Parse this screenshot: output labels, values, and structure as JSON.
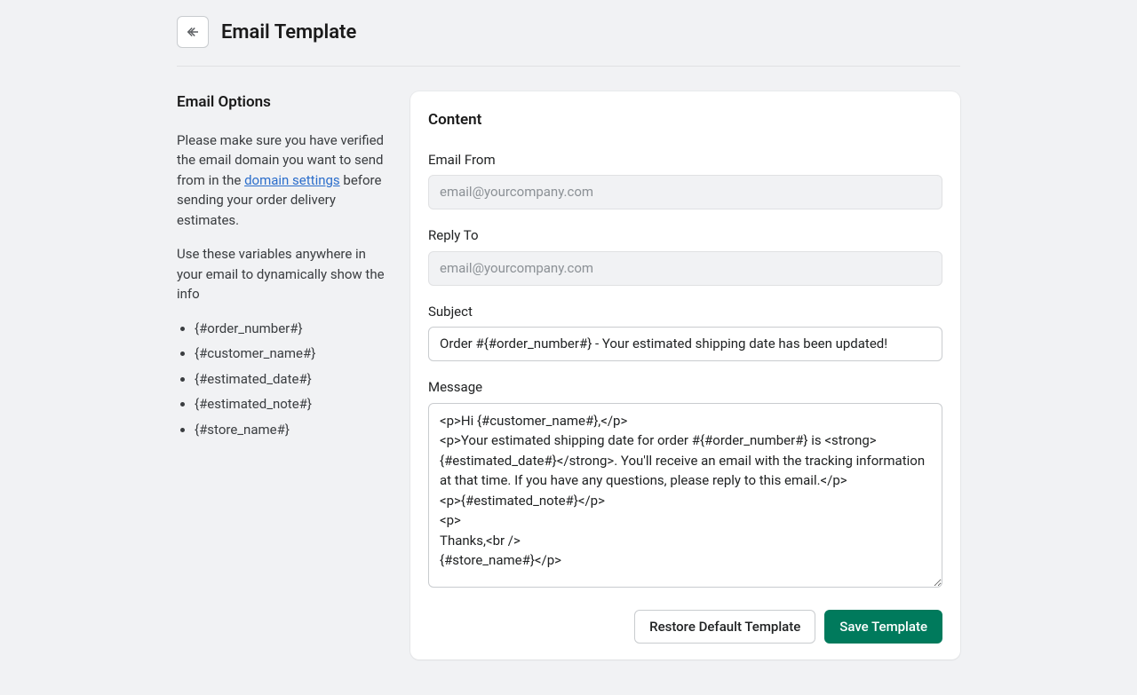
{
  "header": {
    "title": "Email Template"
  },
  "sidebar": {
    "title": "Email Options",
    "intro_part1": "Please make sure you have verified the email domain you want to send from in the ",
    "intro_link": "domain settings",
    "intro_part2": " before sending your order delivery estimates.",
    "variables_intro": "Use these variables anywhere in your email to dynamically show the info",
    "variables": [
      "{#order_number#}",
      "{#customer_name#}",
      "{#estimated_date#}",
      "{#estimated_note#}",
      "{#store_name#}"
    ]
  },
  "content": {
    "title": "Content",
    "email_from": {
      "label": "Email From",
      "placeholder": "email@yourcompany.com",
      "value": ""
    },
    "reply_to": {
      "label": "Reply To",
      "placeholder": "email@yourcompany.com",
      "value": ""
    },
    "subject": {
      "label": "Subject",
      "value": "Order #{#order_number#} - Your estimated shipping date has been updated!"
    },
    "message": {
      "label": "Message",
      "value": "<p>Hi {#customer_name#},</p>\n<p>Your estimated shipping date for order #{#order_number#} is <strong>{#estimated_date#}</strong>. You'll receive an email with the tracking information at that time. If you have any questions, please reply to this email.</p>\n<p>{#estimated_note#}</p>\n<p>\nThanks,<br />\n{#store_name#}</p>"
    },
    "actions": {
      "restore": "Restore Default Template",
      "save": "Save Template"
    }
  }
}
